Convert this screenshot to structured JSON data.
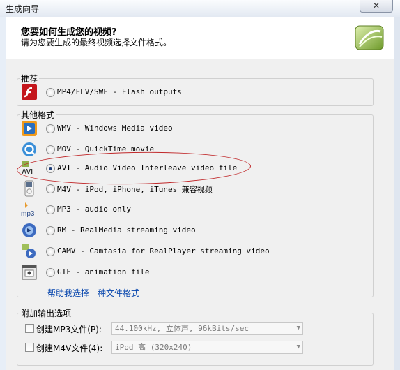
{
  "window": {
    "title": "生成向导",
    "close_label": "✕"
  },
  "header": {
    "title": "您要如何生成您的视频?",
    "subtitle": "请为您要生成的最终视频选择文件格式。"
  },
  "recommended": {
    "label": "推荐",
    "options": [
      {
        "icon": "flash-icon",
        "text": "MP4/FLV/SWF - Flash outputs",
        "selected": false
      }
    ]
  },
  "other_formats": {
    "label": "其他格式",
    "options": [
      {
        "icon": "windows-media-icon",
        "text": "WMV - Windows Media video",
        "selected": false
      },
      {
        "icon": "quicktime-icon",
        "text": "MOV - QuickTime movie",
        "selected": false
      },
      {
        "icon": "avi-icon",
        "text": "AVI - Audio Video Interleave video file",
        "selected": true
      },
      {
        "icon": "ipod-icon",
        "text": "M4V - iPod, iPhone, iTunes 兼容视频",
        "selected": false
      },
      {
        "icon": "mp3-icon",
        "text": "MP3 - audio only",
        "selected": false
      },
      {
        "icon": "realmedia-icon",
        "text": "RM - RealMedia streaming video",
        "selected": false
      },
      {
        "icon": "camv-icon",
        "text": "CAMV - Camtasia for RealPlayer streaming video",
        "selected": false
      },
      {
        "icon": "gif-icon",
        "text": "GIF - animation file",
        "selected": false
      }
    ],
    "help_link": "帮助我选择一种文件格式",
    "avi_icon_text": "AVI",
    "mp3_icon_text": "mp3"
  },
  "additional": {
    "label": "附加输出选项",
    "mp3_option": {
      "label": "创建MP3文件(P):",
      "checked": false,
      "value": "44.100kHz, 立体声, 96kBits/sec"
    },
    "m4v_option": {
      "label": "创建M4V文件(4):",
      "checked": false,
      "value": "iPod 高 (320x240)"
    }
  },
  "colors": {
    "accent_annotation": "#c0282a",
    "link": "#0645ad"
  }
}
